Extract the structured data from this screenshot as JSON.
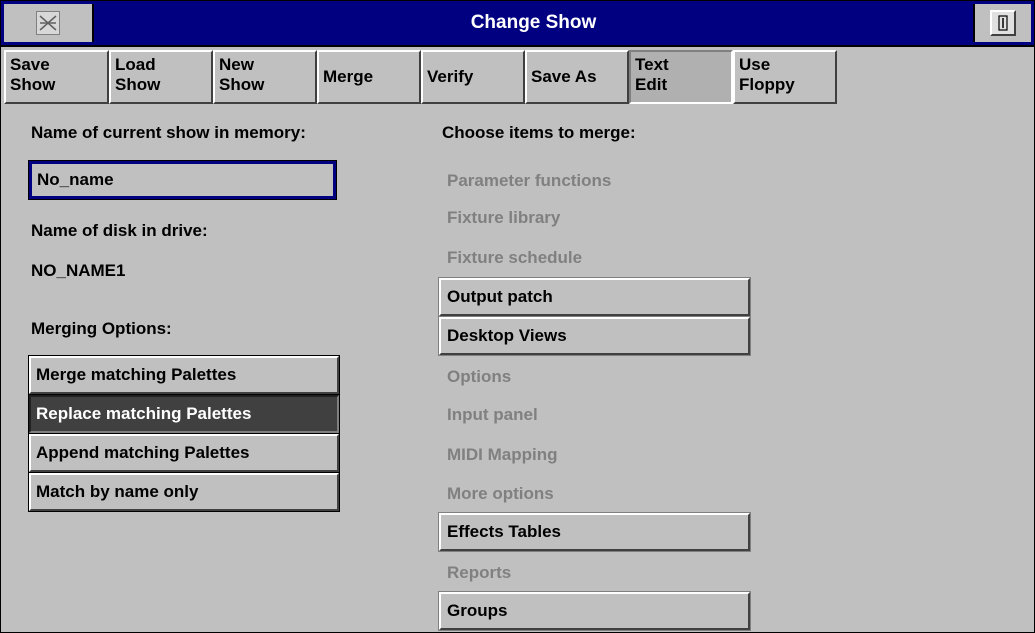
{
  "window": {
    "title": "Change Show"
  },
  "tabs": [
    {
      "label": "Save\nShow",
      "name": "tab-save-show"
    },
    {
      "label": "Load\nShow",
      "name": "tab-load-show"
    },
    {
      "label": "New\nShow",
      "name": "tab-new-show"
    },
    {
      "label": "Merge",
      "name": "tab-merge"
    },
    {
      "label": "Verify",
      "name": "tab-verify"
    },
    {
      "label": "Save As",
      "name": "tab-save-as"
    },
    {
      "label": "Text\nEdit",
      "name": "tab-text-edit",
      "pressed": true
    },
    {
      "label": "Use\nFloppy",
      "name": "tab-use-floppy"
    }
  ],
  "left": {
    "current_show_label": "Name of current show in memory:",
    "current_show_value": "No_name",
    "disk_label": "Name of disk in drive:",
    "disk_value": "NO_NAME1",
    "merging_options_label": "Merging Options:",
    "options": [
      {
        "label": "Merge matching Palettes",
        "selected": false
      },
      {
        "label": "Replace matching Palettes",
        "selected": true
      },
      {
        "label": "Append matching Palettes",
        "selected": false
      },
      {
        "label": "Match by name only",
        "selected": false
      }
    ]
  },
  "right": {
    "heading": "Choose items to merge:",
    "items": [
      {
        "label": "Parameter functions",
        "enabled": false
      },
      {
        "label": "Fixture library",
        "enabled": false
      },
      {
        "label": "Fixture schedule",
        "enabled": false
      },
      {
        "label": "Output patch",
        "enabled": true
      },
      {
        "label": "Desktop Views",
        "enabled": true
      },
      {
        "label": "Options",
        "enabled": false
      },
      {
        "label": "Input panel",
        "enabled": false
      },
      {
        "label": "MIDI Mapping",
        "enabled": false
      },
      {
        "label": "More options",
        "enabled": false
      },
      {
        "label": "Effects Tables",
        "enabled": true
      },
      {
        "label": "Reports",
        "enabled": false
      },
      {
        "label": "Groups",
        "enabled": true
      }
    ]
  },
  "colors": {
    "titlebar": "#000080",
    "face": "#c0c0c0",
    "disabled_text": "#808080",
    "selected_option": "#404040"
  }
}
